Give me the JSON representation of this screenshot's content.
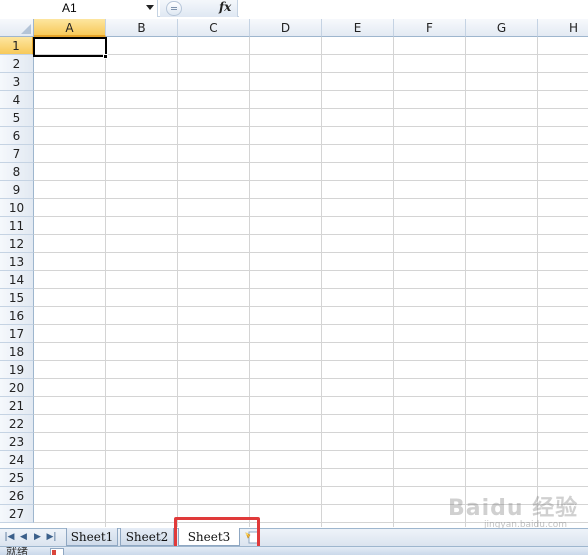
{
  "formula_bar": {
    "name_box_value": "A1",
    "fx_label": "fx",
    "formula_value": ""
  },
  "columns": [
    "A",
    "B",
    "C",
    "D",
    "E",
    "F",
    "G",
    "H"
  ],
  "rows": [
    "1",
    "2",
    "3",
    "4",
    "5",
    "6",
    "7",
    "8",
    "9",
    "10",
    "11",
    "12",
    "13",
    "14",
    "15",
    "16",
    "17",
    "18",
    "19",
    "20",
    "21",
    "22",
    "23",
    "24",
    "25",
    "26",
    "27"
  ],
  "selected_cell": "A1",
  "sheet_tabs": [
    {
      "label": "Sheet1",
      "active": false
    },
    {
      "label": "Sheet2",
      "active": false
    },
    {
      "label": "Sheet3",
      "active": true
    }
  ],
  "status_bar": {
    "ready_text": "就绪"
  },
  "watermark": {
    "text": "Baidu 经验",
    "sub": "jingyan.baidu.com"
  },
  "colors": {
    "highlight_box": "#e03a3a",
    "selected_header": "#f7c95a",
    "grid_line": "#d4d4d4"
  }
}
